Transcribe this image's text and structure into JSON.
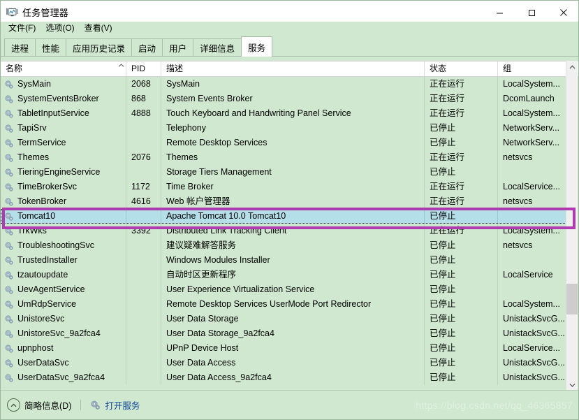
{
  "window": {
    "title": "任务管理器",
    "icon": "task-manager-icon",
    "minimize_label": "–",
    "maximize_label": "☐",
    "close_label": "✕"
  },
  "menubar": {
    "items": [
      {
        "label": "文件(F)"
      },
      {
        "label": "选项(O)"
      },
      {
        "label": "查看(V)"
      }
    ]
  },
  "tabs": [
    {
      "label": "进程",
      "active": false
    },
    {
      "label": "性能",
      "active": false
    },
    {
      "label": "应用历史记录",
      "active": false
    },
    {
      "label": "启动",
      "active": false
    },
    {
      "label": "用户",
      "active": false
    },
    {
      "label": "详细信息",
      "active": false
    },
    {
      "label": "服务",
      "active": true
    }
  ],
  "table": {
    "columns": [
      {
        "key": "name",
        "label": "名称",
        "sorted": true,
        "sort_caret": "˄"
      },
      {
        "key": "pid",
        "label": "PID"
      },
      {
        "key": "desc",
        "label": "描述"
      },
      {
        "key": "status",
        "label": "状态"
      },
      {
        "key": "group",
        "label": "组"
      }
    ],
    "rows": [
      {
        "name": "SysMain",
        "pid": "2068",
        "desc": "SysMain",
        "status": "正在运行",
        "group": "LocalSystem..."
      },
      {
        "name": "SystemEventsBroker",
        "pid": "868",
        "desc": "System Events Broker",
        "status": "正在运行",
        "group": "DcomLaunch"
      },
      {
        "name": "TabletInputService",
        "pid": "4888",
        "desc": "Touch Keyboard and Handwriting Panel Service",
        "status": "正在运行",
        "group": "LocalSystem..."
      },
      {
        "name": "TapiSrv",
        "pid": "",
        "desc": "Telephony",
        "status": "已停止",
        "group": "NetworkServ..."
      },
      {
        "name": "TermService",
        "pid": "",
        "desc": "Remote Desktop Services",
        "status": "已停止",
        "group": "NetworkServ..."
      },
      {
        "name": "Themes",
        "pid": "2076",
        "desc": "Themes",
        "status": "正在运行",
        "group": "netsvcs"
      },
      {
        "name": "TieringEngineService",
        "pid": "",
        "desc": "Storage Tiers Management",
        "status": "已停止",
        "group": ""
      },
      {
        "name": "TimeBrokerSvc",
        "pid": "1172",
        "desc": "Time Broker",
        "status": "正在运行",
        "group": "LocalService..."
      },
      {
        "name": "TokenBroker",
        "pid": "4616",
        "desc": "Web 帐户管理器",
        "status": "正在运行",
        "group": "netsvcs"
      },
      {
        "name": "Tomcat10",
        "pid": "",
        "desc": "Apache Tomcat 10.0 Tomcat10",
        "status": "已停止",
        "group": "",
        "selected": true
      },
      {
        "name": "TrkWks",
        "pid": "3392",
        "desc": "Distributed Link Tracking Client",
        "status": "正在运行",
        "group": "LocalSystem..."
      },
      {
        "name": "TroubleshootingSvc",
        "pid": "",
        "desc": "建议疑难解答服务",
        "status": "已停止",
        "group": "netsvcs"
      },
      {
        "name": "TrustedInstaller",
        "pid": "",
        "desc": "Windows Modules Installer",
        "status": "已停止",
        "group": ""
      },
      {
        "name": "tzautoupdate",
        "pid": "",
        "desc": "自动时区更新程序",
        "status": "已停止",
        "group": "LocalService"
      },
      {
        "name": "UevAgentService",
        "pid": "",
        "desc": "User Experience Virtualization Service",
        "status": "已停止",
        "group": ""
      },
      {
        "name": "UmRdpService",
        "pid": "",
        "desc": "Remote Desktop Services UserMode Port Redirector",
        "status": "已停止",
        "group": "LocalSystem..."
      },
      {
        "name": "UnistoreSvc",
        "pid": "",
        "desc": "User Data Storage",
        "status": "已停止",
        "group": "UnistackSvcG..."
      },
      {
        "name": "UnistoreSvc_9a2fca4",
        "pid": "",
        "desc": "User Data Storage_9a2fca4",
        "status": "已停止",
        "group": "UnistackSvcG..."
      },
      {
        "name": "upnphost",
        "pid": "",
        "desc": "UPnP Device Host",
        "status": "已停止",
        "group": "LocalService..."
      },
      {
        "name": "UserDataSvc",
        "pid": "",
        "desc": "User Data Access",
        "status": "已停止",
        "group": "UnistackSvcG..."
      },
      {
        "name": "UserDataSvc_9a2fca4",
        "pid": "",
        "desc": "User Data Access_9a2fca4",
        "status": "已停止",
        "group": "UnistackSvcG..."
      }
    ]
  },
  "scrollbar": {
    "up_arrow": "˄",
    "down_arrow": "˅"
  },
  "statusbar": {
    "fewer_details_label": "简略信息(D)",
    "fewer_details_caret": "˄",
    "open_services_label": "打开服务",
    "open_services_icon": "services-gear-icon"
  },
  "watermark": {
    "text": "https://blog.csdn.net/qq_46365857"
  },
  "colors": {
    "window_bg": "#cfe8cf",
    "selection": "#b4dee8",
    "annotation": "#b03ab0",
    "link": "#12479b"
  }
}
